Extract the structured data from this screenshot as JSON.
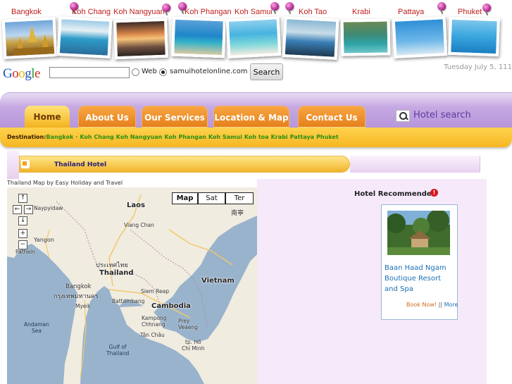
{
  "destinations": [
    {
      "label": "Bangkok"
    },
    {
      "label": "Koh Chang"
    },
    {
      "label": "Koh Nangyuan"
    },
    {
      "label": "Koh Phangan"
    },
    {
      "label": "Koh Samui"
    },
    {
      "label": "Koh Tao"
    },
    {
      "label": "Krabi"
    },
    {
      "label": "Pattaya"
    },
    {
      "label": "Phuket"
    }
  ],
  "search": {
    "value": "",
    "option_web": "Web",
    "option_site": "samuihotelonline.com",
    "selected": "samuihotelonline.com",
    "button": "Search"
  },
  "date_text": "Tuesday July 5, 111",
  "nav": {
    "tabs": [
      "Home",
      "About Us",
      "Our Services",
      "Location & Map",
      "Contact Us"
    ],
    "active": "Home",
    "hotel_search": "Hotel search"
  },
  "destination_bar": {
    "label": "Destination:",
    "links": [
      "Bangkok",
      "Koh Chang",
      "Koh Nangyuan",
      "Koh Phangan",
      "Koh Samui",
      "Koh toa",
      "Krabi",
      "Pattaya",
      "Phuket"
    ]
  },
  "section_title": "Thailand Hotel",
  "map": {
    "caption": "Thailand Map by Easy Holiday and Travel",
    "types": [
      "Map",
      "Sat",
      "Ter"
    ],
    "active_type": "Map",
    "controls": {
      "up": "↑",
      "left": "←",
      "right": "→",
      "down": "↓",
      "zoom_in": "+",
      "zoom_out": "−"
    },
    "labels": {
      "laos": "Laos",
      "thailand": "Thailand",
      "thailand_thai": "ประเทศไทย",
      "vietnam": "Vietnam",
      "cambodia": "Cambodia",
      "bangkok": "Bangkok",
      "bangkok_thai": "กรุงเทพมหานคร",
      "yangon": "Yangon",
      "pathein": "Pathein",
      "naypyidaw": "Naypyidaw",
      "vientiane": "Viang Chan",
      "siem_reap": "Siem Reap",
      "battambang": "Battambang",
      "kampong_chhnang": "Kampong\nChhnang",
      "prey_veng": "Prey\nVeaeng",
      "tan_chau": "Tân Châu",
      "hcm": "tp. Hồ\nChí Minh",
      "myeik": "Myeik",
      "andaman": "Andaman\nSea",
      "gulf": "Gulf of\nThailand",
      "china_chars": "南寧"
    }
  },
  "recommend": {
    "title": "Hotel Recommended",
    "hotel_name": "Baan Haad Ngam Boutique Resort and Spa",
    "book": "Book Now!",
    "sep": "||",
    "more": "More"
  },
  "colors": {
    "nav_purple": "#b796da",
    "tab_orange": "#e57f1b",
    "home_yellow": "#f3b21a",
    "dest_green": "#2a8f12",
    "map_water": "#99b3cc",
    "map_land": "#f1ece0"
  }
}
